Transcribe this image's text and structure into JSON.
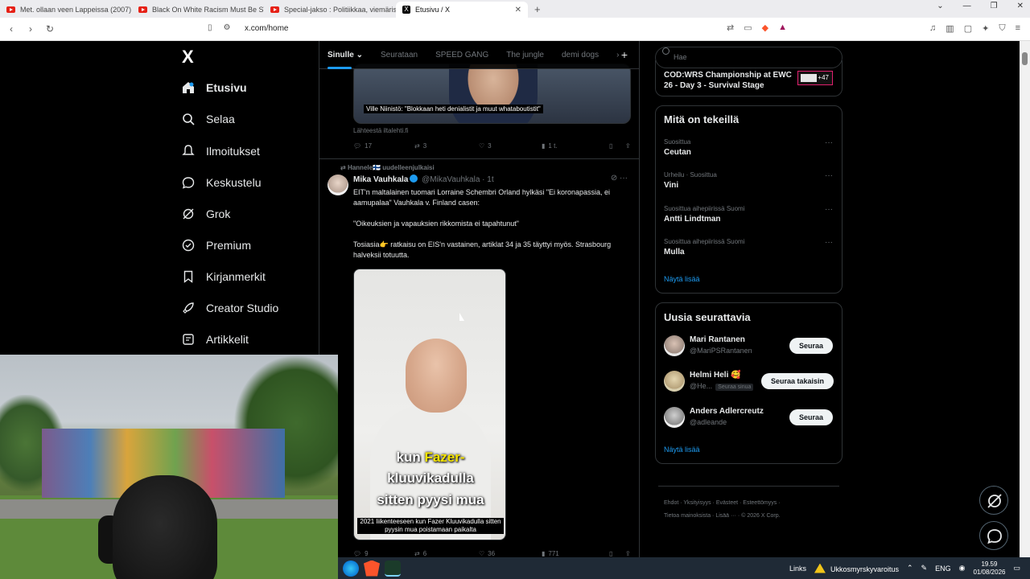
{
  "browser": {
    "tabs": [
      {
        "title": "Met. ollaan veen Lappeissa (2007) -"
      },
      {
        "title": "Black On White Racism Must Be STOP"
      },
      {
        "title": "Special-jakso : Politiikkaa, viemäris Tä"
      },
      {
        "title": "Etusivu / X"
      }
    ],
    "url": "x.com/home",
    "new_tab": "+"
  },
  "sidebar": {
    "logo": "X",
    "items": [
      {
        "label": "Etusivu"
      },
      {
        "label": "Selaa"
      },
      {
        "label": "Ilmoitukset"
      },
      {
        "label": "Keskustelu"
      },
      {
        "label": "Grok"
      },
      {
        "label": "Premium"
      },
      {
        "label": "Kirjanmerkit"
      },
      {
        "label": "Creator Studio"
      },
      {
        "label": "Artikkelit"
      }
    ]
  },
  "timeline": {
    "tabs": [
      {
        "label": "Sinulle"
      },
      {
        "label": "Seurataan"
      },
      {
        "label": "SPEED GANG"
      },
      {
        "label": "The jungle"
      },
      {
        "label": "demi dogs"
      }
    ],
    "add": "+",
    "prev_tweet": {
      "caption": "Ville Niinistö: \"Blokkaan heti denialistit ja muut whataboutistit\"",
      "source": "Lähteestä iltalehti.fi",
      "replies": "17",
      "reposts": "3",
      "likes": "3",
      "views": "1 t."
    },
    "tweet": {
      "repost_line": "Hannele🇫🇮 uudelleenjulkaisi",
      "name": "Mika Vauhkala",
      "handle": "@MikaVauhkala · 1t",
      "text1": "EIT'n maltalainen tuomari Lorraine Schembri Orland hylkäsi \"Ei koronapassia, ei aamupalaa\" Vauhkala v. Finland casen:",
      "text2": "\"Oikeuksien ja vapauksien rikkomista ei tapahtunut\"",
      "text3": "Tosiasia👉 ratkaisu on EIS'n vastainen, artiklat 34 ja 35 täyttyi myös. Strasbourg halveksii totuutta.",
      "video_caption_1": "kun Fazer-",
      "video_caption_1_plain": "kun ",
      "video_caption_1_yellow": "Fazer-",
      "video_caption_2": "kluuvikadulla",
      "video_caption_3": "sitten pyysi mua",
      "video_subtitle": "2021 liikenteeseen kun Fazer Kluuvikadulla sitten pyysin mua poistamaan paikalta",
      "replies": "9",
      "reposts": "6",
      "likes": "36",
      "views": "771"
    }
  },
  "right": {
    "search_placeholder": "Hae",
    "promo_title": "COD:WRS Championship at EWC 26 - Day 3 - Survival Stage",
    "promo_badge": "+47",
    "trends_title": "Mitä on tekeillä",
    "trends": [
      {
        "context": "Suosittua",
        "title": "Ceutan"
      },
      {
        "context": "Urheilu · Suosittua",
        "title": "Vini"
      },
      {
        "context": "Suosittua aihepiirissä Suomi",
        "title": "Antti Lindtman"
      },
      {
        "context": "Suosittua aihepiirissä Suomi",
        "title": "Mulla"
      }
    ],
    "show_more": "Näytä lisää",
    "follow_title": "Uusia seurattavia",
    "follows": [
      {
        "name": "Mari Rantanen",
        "handle": "@MariPSRantanen",
        "button": "Seuraa"
      },
      {
        "name": "Helmi Heli 🥰",
        "handle": "@He...",
        "follows_you": "Seuraa sinua",
        "button": "Seuraa takaisin"
      },
      {
        "name": "Anders Adlercreutz",
        "handle": "@adleande",
        "button": "Seuraa"
      }
    ],
    "show_more_2": "Näytä lisää",
    "footer_line1": "Ehdot  ·  Yksityisyys  ·  Evästeet  ·  Esteettömyys  ·",
    "footer_line2": "Tietoa mainoksista  ·  Lisää ···  ·  © 2026 X Corp."
  },
  "taskbar": {
    "links": "Links",
    "weather": "Ukkosmyrskyvaroitus",
    "lang": "ENG",
    "time": "19.59",
    "date": "01/08/2026"
  }
}
